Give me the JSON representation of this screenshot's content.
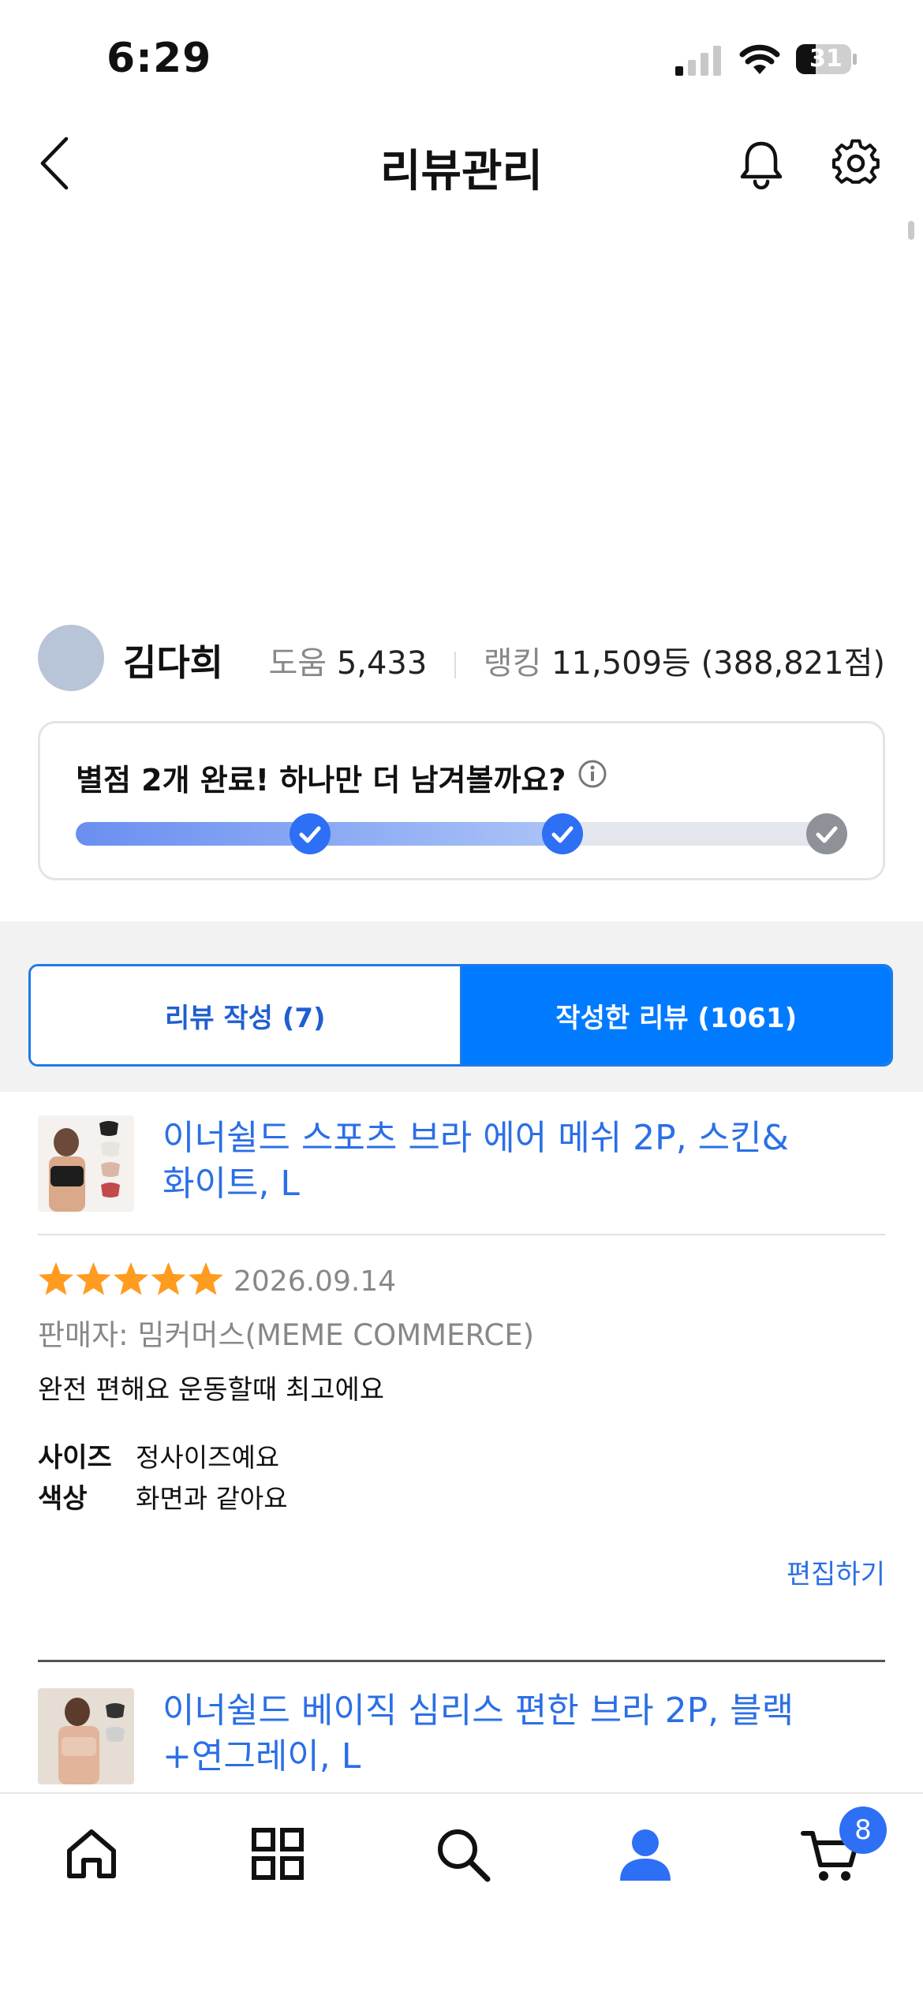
{
  "status_bar": {
    "time": "6:29",
    "battery": "31"
  },
  "header": {
    "title": "리뷰관리"
  },
  "profile": {
    "name": "김다희",
    "help_label": "도움",
    "help_count": "5,433",
    "rank_label": "랭킹",
    "rank_value": "11,509등 (388,821점)"
  },
  "progress_card": {
    "message": "별점 2개 완료! 하나만 더 남겨볼까요?",
    "completed_steps": 2,
    "total_steps": 3
  },
  "tabs": [
    {
      "label": "리뷰 작성 (7)",
      "active": false
    },
    {
      "label": "작성한 리뷰 (1061)",
      "active": true
    }
  ],
  "reviews": [
    {
      "product": "이너쉴드 스포츠 브라 에어 메쉬 2P, 스킨&\n화이트, L",
      "rating": 5,
      "date": "2026.09.14",
      "seller": "판매자: 밈커머스(MEME COMMERCE)",
      "text": "완전 편해요 운동할때 최고에요",
      "attributes": [
        {
          "key": "사이즈",
          "value": "정사이즈예요"
        },
        {
          "key": "색상",
          "value": "화면과 같아요"
        }
      ],
      "edit_label": "편집하기"
    },
    {
      "product": "이너쉴드 베이직 심리스 편한 브라 2P, 블랙\n+연그레이, L"
    }
  ],
  "bottom_nav": {
    "items": [
      "home-icon",
      "category-icon",
      "search-icon",
      "my-page-icon",
      "cart-icon"
    ],
    "cart_count": "8",
    "active": "my-page-icon"
  },
  "colors": {
    "accent": "#007bff",
    "link": "#2b6fe6",
    "star": "#ff9b1f"
  }
}
